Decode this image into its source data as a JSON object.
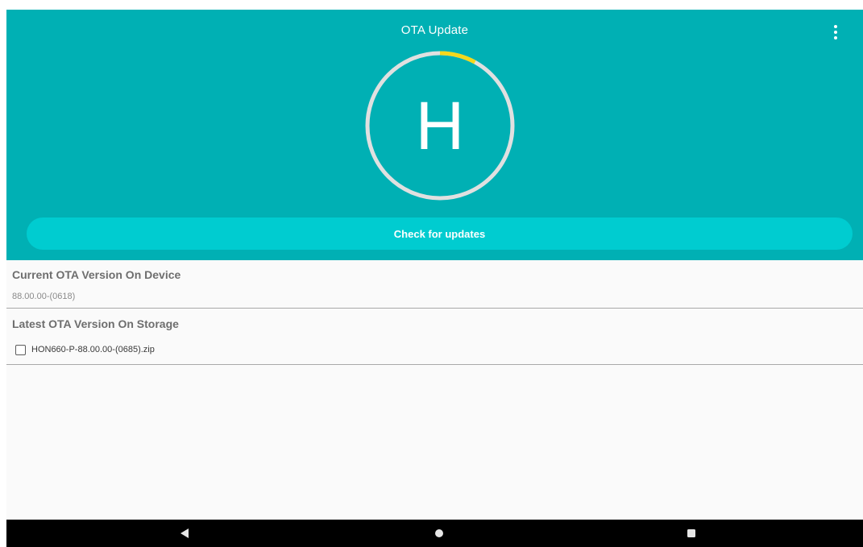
{
  "app": {
    "title": "OTA Update",
    "logo_letter": "H",
    "check_button_label": "Check for updates",
    "menu_icon": "more-vert-icon"
  },
  "progress_ring": {
    "progress_fraction": 0.08,
    "ring_color": "#e0e0e0",
    "progress_color": "#f4d81c"
  },
  "current_section": {
    "title": "Current OTA Version On Device",
    "version": "88.00.00-(0618)"
  },
  "latest_section": {
    "title": "Latest OTA Version On Storage",
    "files": [
      {
        "name": "HON660-P-88.00.00-(0685).zip",
        "checked": false
      }
    ]
  },
  "navbar": {
    "back_icon": "back-triangle-icon",
    "home_icon": "home-circle-icon",
    "recents_icon": "recents-square-icon"
  },
  "colors": {
    "header_bg": "#00b0b4",
    "button_bg": "#00ccd0",
    "page_bg": "#fafafa",
    "navbar_bg": "#000000"
  }
}
